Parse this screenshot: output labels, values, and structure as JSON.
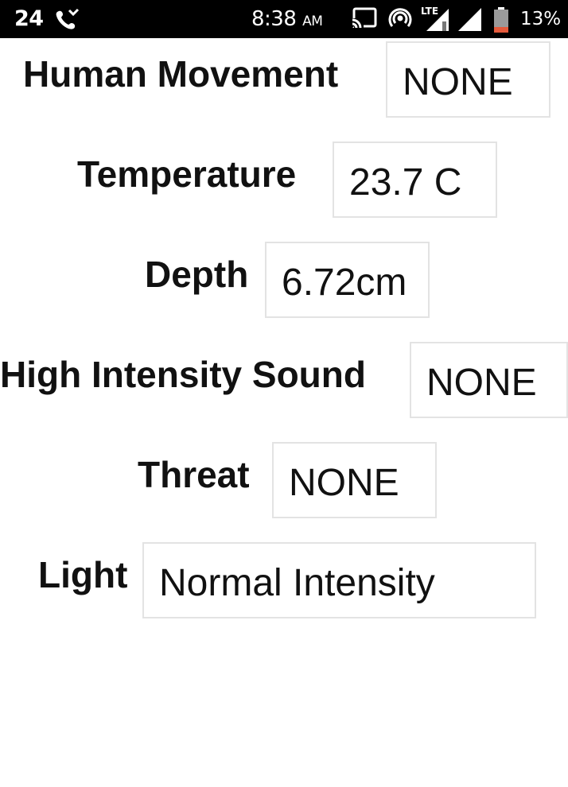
{
  "status_bar": {
    "left_number": "24",
    "time": "8:38",
    "ampm": "AM",
    "network_label": "LTE",
    "battery_percent": "13%",
    "icons": [
      "missed-call-icon",
      "cast-icon",
      "hotspot-icon",
      "lte-signal-icon",
      "signal-icon",
      "battery-icon"
    ]
  },
  "sensors": [
    {
      "label": "Human Movement",
      "value": "NONE"
    },
    {
      "label": "Temperature",
      "value": "23.7 C"
    },
    {
      "label": "Depth",
      "value": "6.72cm"
    },
    {
      "label": "High Intensity Sound",
      "value": "NONE"
    },
    {
      "label": "Threat",
      "value": "NONE"
    },
    {
      "label": "Light",
      "value": "Normal Intensity"
    }
  ],
  "colors": {
    "status_bar_bg": "#000000",
    "battery_low": "#e55a3c",
    "field_border": "#e3e3e3"
  }
}
